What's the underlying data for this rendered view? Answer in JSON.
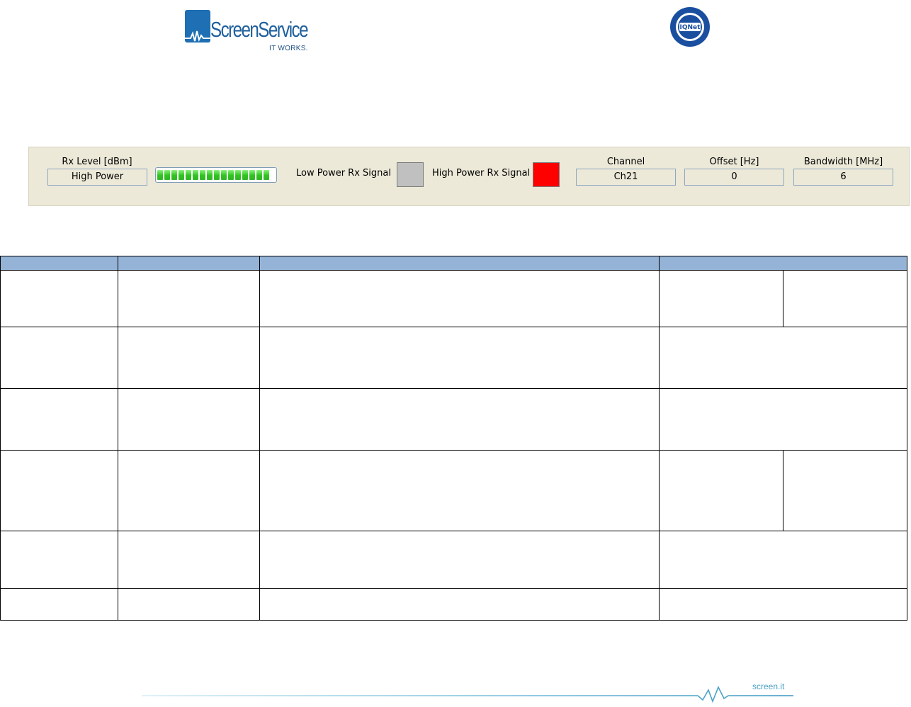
{
  "header": {
    "brand_logo": "ScreenService",
    "brand_tagline": "IT WORKS.",
    "cert_logo": "IQNet"
  },
  "status_panel": {
    "rx_level": {
      "label": "Rx Level [dBm]",
      "value": "High Power"
    },
    "level_meter": {
      "fill": 1.0,
      "segments": 16,
      "color": "#2fc21f"
    },
    "low_power_rx_signal": {
      "label": "Low Power Rx Signal",
      "state_color": "#c0c0c0"
    },
    "high_power_rx_signal": {
      "label": "High Power Rx Signal",
      "state_color": "#ff0000"
    },
    "channel": {
      "label": "Channel",
      "value": "Ch21"
    },
    "offset": {
      "label": "Offset [Hz]",
      "value": "0"
    },
    "bandwidth": {
      "label": "Bandwidth [MHz]",
      "value": "6"
    }
  },
  "table": {
    "header_color": "#95b3d7",
    "rows": [
      {
        "split_last": true
      },
      {
        "split_last": false
      },
      {
        "split_last": false
      },
      {
        "split_last": true
      },
      {
        "split_last": false
      },
      {
        "split_last": false
      }
    ]
  },
  "footer": {
    "site": "screen.it"
  }
}
